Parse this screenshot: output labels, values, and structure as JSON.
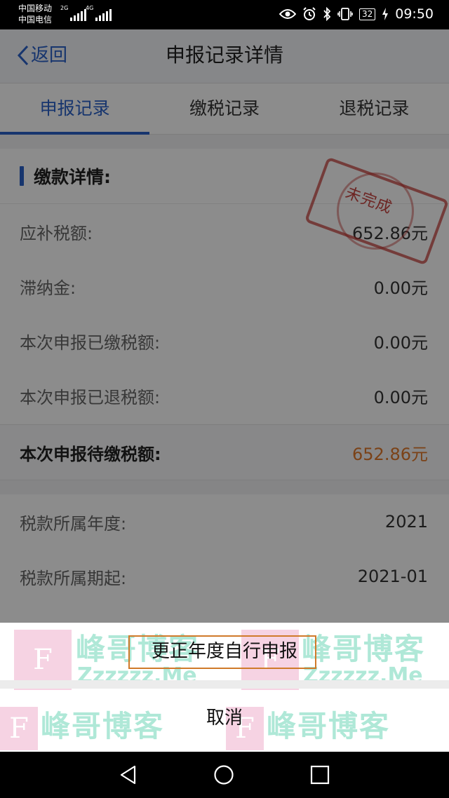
{
  "status_bar": {
    "carrier_1": "中国移动",
    "carrier_2": "中国电信",
    "net_1": "2G",
    "net_2": "4G",
    "battery": "32",
    "time": "09:50",
    "icons": [
      "eye-icon",
      "alarm-icon",
      "bluetooth-icon",
      "vibrate-icon",
      "battery-icon",
      "charging-icon"
    ]
  },
  "header": {
    "back_label": "返回",
    "title": "申报记录详情"
  },
  "tabs": [
    {
      "label": "申报记录",
      "active": true
    },
    {
      "label": "缴税记录",
      "active": false
    },
    {
      "label": "退税记录",
      "active": false
    }
  ],
  "payment_section": {
    "title": "缴款详情:",
    "stamp_text": "未完成",
    "rows": [
      {
        "label": "应补税额:",
        "value": "652.86元"
      },
      {
        "label": "滞纳金:",
        "value": "0.00元"
      },
      {
        "label": "本次申报已缴税额:",
        "value": "0.00元"
      },
      {
        "label": "本次申报已退税额:",
        "value": "0.00元"
      }
    ],
    "pending": {
      "label": "本次申报待缴税额:",
      "value": "652.86元"
    }
  },
  "period_section": {
    "rows": [
      {
        "label": "税款所属年度:",
        "value": "2021"
      },
      {
        "label": "税款所属期起:",
        "value": "2021-01"
      }
    ]
  },
  "action_sheet": {
    "option_1": "更正年度自行申报",
    "cancel": "取消"
  },
  "watermark": {
    "logo_letter": "F",
    "name": "峰哥博客",
    "domain": "Zzzzzz.Me"
  },
  "colors": {
    "accent": "#2a62c8",
    "pending_amount": "#e0782a",
    "stamp": "#c0302c",
    "highlight_frame": "#d07a2a"
  }
}
